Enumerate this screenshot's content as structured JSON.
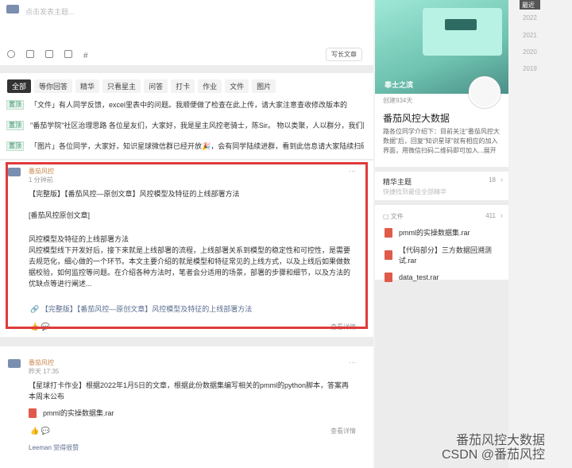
{
  "composer": {
    "placeholder": "点击发表主题..."
  },
  "composer_action": "写长文章",
  "tabs": [
    "全部",
    "等你回答",
    "精华",
    "只看星主",
    "问答",
    "打卡",
    "作业",
    "文件",
    "图片"
  ],
  "pinned": [
    {
      "tag": "置顶",
      "text": "「文件」有人同学反馈，excel里表中的问题。我顺便做了检查在此上传，请大家注意查收修改版本的"
    },
    {
      "tag": "置顶",
      "text": "\"番茄学院\"社区治理思路 各位星友们，大家好，我是星主风控老骑士，陈Sir。 物以类聚，人以群分，我们因风控..."
    },
    {
      "tag": "置顶",
      "text": "「图片」各位同学，大家好，知识星球微信群已经开放🎉，会有同学陆续进群，看到此信息请大家陆续扫码进群..."
    }
  ],
  "post1": {
    "author": "番茄风控",
    "time": "1 分钟前",
    "title": "【完整版】【番茄风控—原创文章】风控模型及特征的上线部署方法",
    "sub": "[番茄风控原创文章]",
    "heading": "风控模型及特征的上线部署方法",
    "body": "风控模型线下开发好后，接下来就是上线部署的流程，上线部署关系到模型的稳定性和可控性，是需要去规范化，细心做的一个环节。本文主要介绍的就是模型和特征常见的上线方式，以及上线后如果做数据校验，如何监控等问题。在介绍各种方法时，笔者会分适用的场景，部署的步骤和细节，以及方法的优缺点等进行阐述...",
    "link": "【完整版】【番茄风控—原创文章】风控模型及特征的上线部署方法",
    "detail": "查看详情"
  },
  "post2": {
    "author": "番茄风控",
    "time": "昨天 17:35",
    "text": "【星球打卡作业】根据2022年1月5日的文章，根据此份数据集编写相关的pmml的python脚本，答案再本周末公布",
    "file": "pmml的实操数据集.rar",
    "detail": "查看详情",
    "footer": "Leeman 觉得很赞"
  },
  "side": {
    "banner": "奉士之滨",
    "created": "创建934天",
    "name": "番茄风控大数据",
    "desc": "路各位同学介绍下：目前关注\"番茄风控大数据\"后，回复\"知识星球\"就有相应的加入界面，用微信扫码二维码即可加入...展开",
    "featured": "精华主题",
    "featured_count": "18",
    "featured_sub": "快捷找到最佳全部精华",
    "files_title": "文件",
    "files_count": "411",
    "files": [
      "pmml的实操数据集.rar",
      "【代码部分】三方数据回溯测试.rar",
      "data_test.rar"
    ]
  },
  "years": [
    "最近",
    "2022",
    "2021",
    "2020",
    "2019"
  ],
  "watermark": "番茄风控大数据\nCSDN @番茄风控"
}
